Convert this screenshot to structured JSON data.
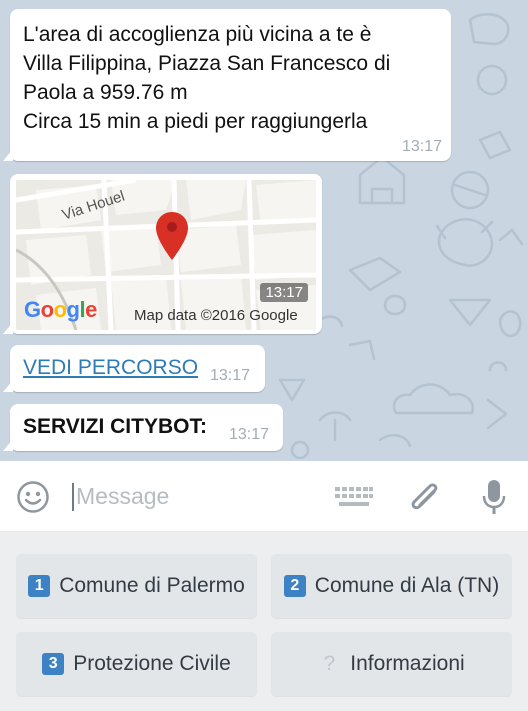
{
  "messages": {
    "first": {
      "text": "L'area di accoglienza più vicina a te è\nVilla Filippina, Piazza San Francesco di\nPaola a 959.76 m\nCirca 15 min a piedi per raggiungerla",
      "time": "13:17"
    },
    "map": {
      "street_label": "Via Houel",
      "time": "13:17",
      "google_logo": "Google",
      "map_data": "Map data ©2016 Google"
    },
    "link": {
      "text": "VEDI PERCORSO",
      "time": "13:17"
    },
    "services": {
      "text": "SERVIZI CITYBOT:",
      "time": "13:17"
    }
  },
  "input": {
    "placeholder": "Message"
  },
  "keyboard": {
    "buttons": [
      {
        "badge": "1",
        "label": "Comune di Palermo"
      },
      {
        "badge": "2",
        "label": "Comune di Ala (TN)"
      },
      {
        "badge": "3",
        "label": "Protezione Civile"
      },
      {
        "badge": "?",
        "label": "Informazioni"
      }
    ]
  },
  "colors": {
    "chat_background": "#c9d5e0",
    "link": "#2e7cb6",
    "badge": "#3d82c4",
    "map_pin": "#d93025"
  }
}
